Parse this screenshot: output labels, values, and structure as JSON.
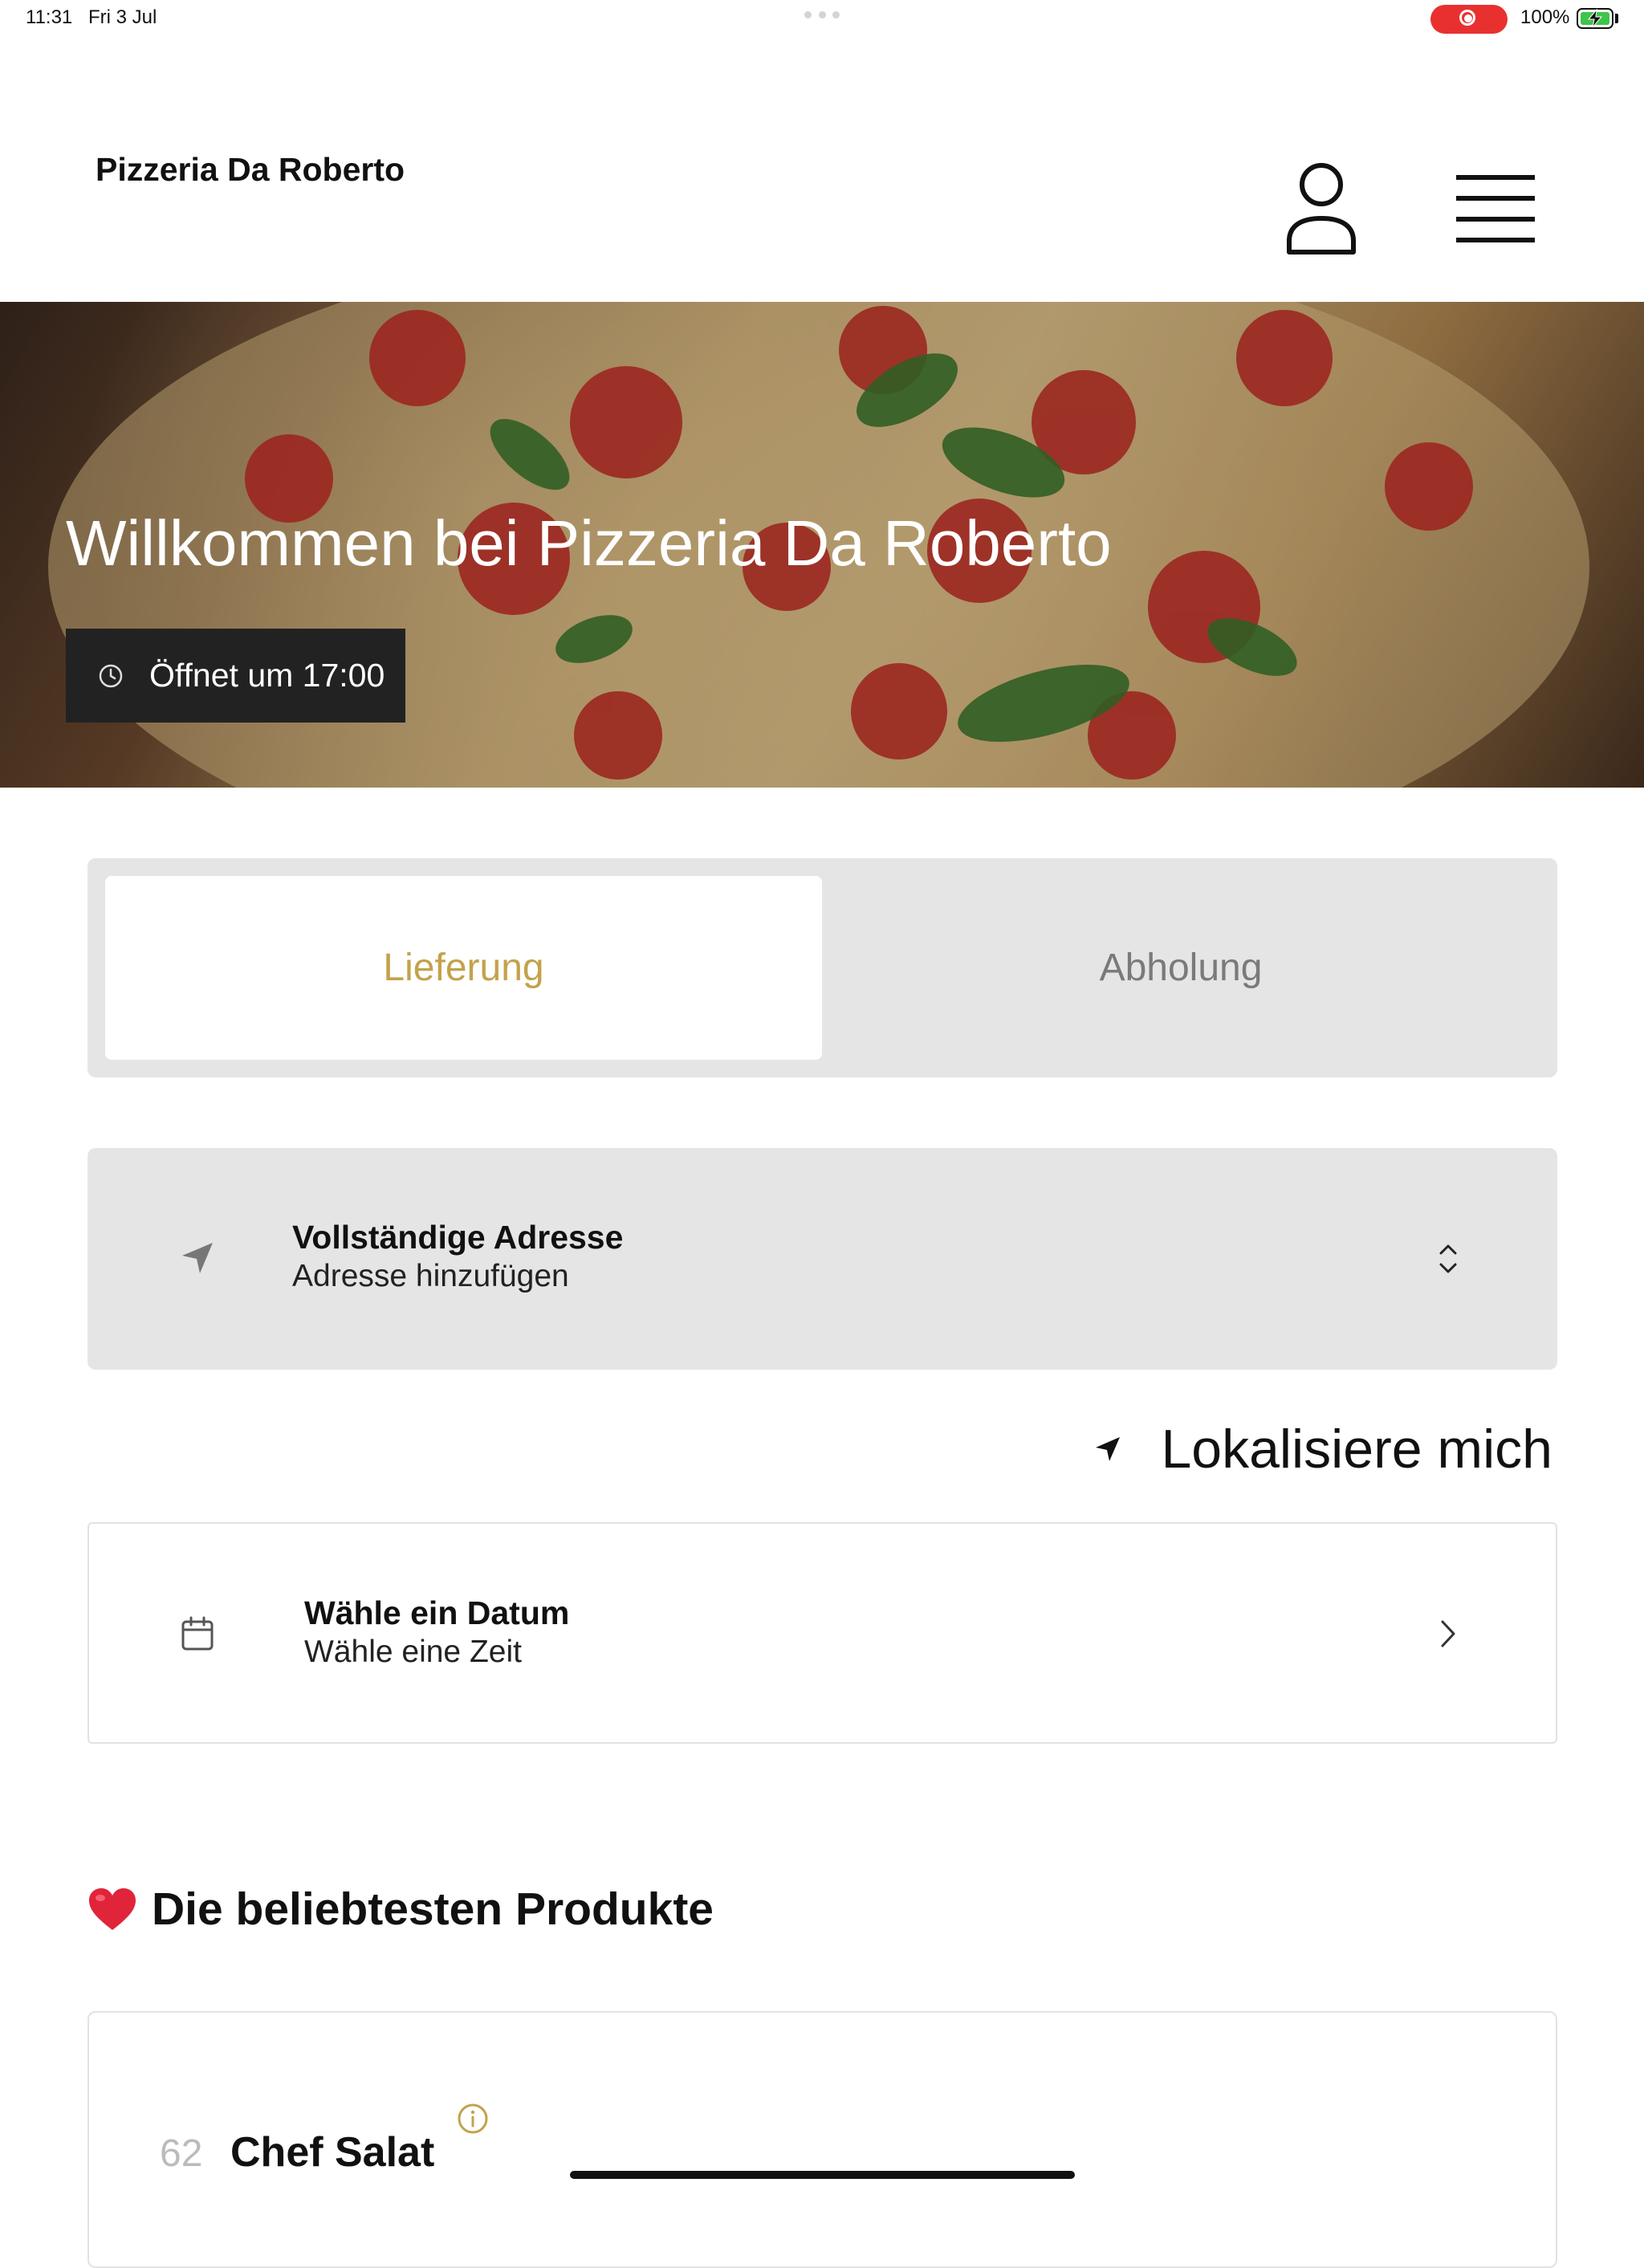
{
  "status_bar": {
    "time": "11:31",
    "date": "Fri 3 Jul",
    "battery": "100%",
    "recording_color": "#e8312f"
  },
  "header": {
    "brand": "Pizzeria Da Roberto",
    "user_icon": "user-icon",
    "menu_icon": "hamburger-menu-icon"
  },
  "hero": {
    "title": "Willkommen bei Pizzeria Da Roberto",
    "opening": "Öffnet um 17:00"
  },
  "order_mode": {
    "tabs": [
      {
        "label": "Lieferung",
        "active": true
      },
      {
        "label": "Abholung",
        "active": false
      }
    ],
    "accent_color": "#c3a24a"
  },
  "address": {
    "title": "Vollständige Adresse",
    "placeholder": "Adresse hinzufügen"
  },
  "locate": {
    "label": "Lokalisiere mich"
  },
  "schedule": {
    "title": "Wähle ein Datum",
    "subtitle": "Wähle eine Zeit"
  },
  "popular": {
    "heading": "Die beliebtesten Produkte",
    "products": [
      {
        "number": "62",
        "name": "Chef Salat"
      }
    ]
  }
}
